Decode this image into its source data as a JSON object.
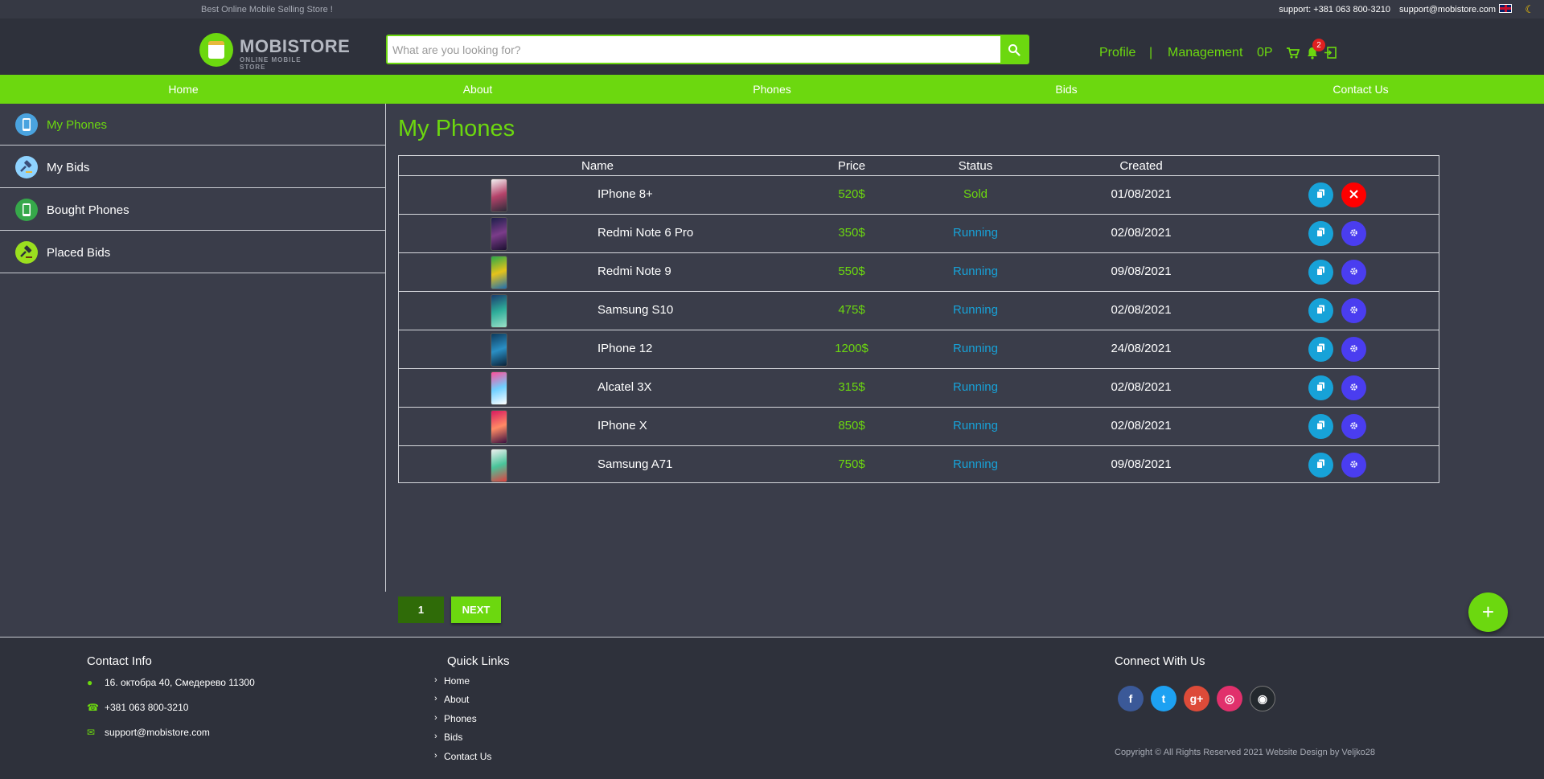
{
  "topbar": {
    "tagline": "Best Online Mobile Selling Store !",
    "phone": "support: +381 063 800-3210",
    "email": "support@mobistore.com"
  },
  "header": {
    "logo_title": "MOBISTORE",
    "logo_subtitle": "ONLINE MOBILE STORE",
    "search_placeholder": "What are you looking for?",
    "profile": "Profile",
    "separator": "|",
    "management": "Management",
    "points": "0P",
    "notification_count": "2"
  },
  "nav": [
    "Home",
    "About",
    "Phones",
    "Bids",
    "Contact Us"
  ],
  "sidebar": [
    {
      "label": "My Phones",
      "icon": "phone-icon",
      "active": true
    },
    {
      "label": "My Bids",
      "icon": "gavel-icon",
      "active": false
    },
    {
      "label": "Bought Phones",
      "icon": "phone-icon",
      "active": false
    },
    {
      "label": "Placed Bids",
      "icon": "gavel-icon",
      "active": false
    }
  ],
  "main": {
    "title": "My Phones",
    "columns": [
      "Name",
      "Price",
      "Status",
      "Created"
    ],
    "rows": [
      {
        "name": "IPhone 8+",
        "price": "520$",
        "status": "Sold",
        "created": "01/08/2021",
        "thumb": [
          "#f2f2f2",
          "#b5436a",
          "#2c2c3a"
        ]
      },
      {
        "name": "Redmi Note 6 Pro",
        "price": "350$",
        "status": "Running",
        "created": "02/08/2021",
        "thumb": [
          "#1d1f4a",
          "#7b3c8a",
          "#1b1030"
        ]
      },
      {
        "name": "Redmi Note 9",
        "price": "550$",
        "status": "Running",
        "created": "09/08/2021",
        "thumb": [
          "#2aa84a",
          "#e6c21a",
          "#1e6fb0"
        ]
      },
      {
        "name": "Samsung S10",
        "price": "475$",
        "status": "Running",
        "created": "02/08/2021",
        "thumb": [
          "#1a3b6e",
          "#2fae9a",
          "#9be0c8"
        ]
      },
      {
        "name": "IPhone 12",
        "price": "1200$",
        "status": "Running",
        "created": "24/08/2021",
        "thumb": [
          "#0d3a5c",
          "#2a8fc4",
          "#0b2238"
        ]
      },
      {
        "name": "Alcatel 3X",
        "price": "315$",
        "status": "Running",
        "created": "02/08/2021",
        "thumb": [
          "#ff4f9a",
          "#6fd0ff",
          "#ffffff"
        ]
      },
      {
        "name": "IPhone X",
        "price": "850$",
        "status": "Running",
        "created": "02/08/2021",
        "thumb": [
          "#d81b60",
          "#ff8a65",
          "#3a1040"
        ]
      },
      {
        "name": "Samsung A71",
        "price": "750$",
        "status": "Running",
        "created": "09/08/2021",
        "thumb": [
          "#f0f0f0",
          "#49c49a",
          "#e04040"
        ]
      }
    ]
  },
  "pagination": {
    "current": "1",
    "next": "NEXT"
  },
  "fab": "+",
  "footer": {
    "contact_title": "Contact Info",
    "address": "16. октобра 40, Смедерево 11300",
    "phone": "+381 063 800-3210",
    "email": "support@mobistore.com",
    "links_title": "Quick Links",
    "links": [
      "Home",
      "About",
      "Phones",
      "Bids",
      "Contact Us"
    ],
    "connect_title": "Connect With Us",
    "social": [
      {
        "name": "facebook-icon",
        "glyph": "f",
        "color": "#3b5998"
      },
      {
        "name": "twitter-icon",
        "glyph": "t",
        "color": "#1da1f2"
      },
      {
        "name": "google-plus-icon",
        "glyph": "g+",
        "color": "#dd4b39"
      },
      {
        "name": "instagram-icon",
        "glyph": "◎",
        "color": "#e1306c"
      },
      {
        "name": "github-icon",
        "glyph": "◉",
        "color": "#24292e"
      }
    ],
    "copyright": "Copyright © All Rights Reserved 2021 Website Design by Veljko28"
  },
  "colors": {
    "accent": "#6cd80f",
    "running": "#17a2d8",
    "sold": "#6cd80f",
    "danger": "#ff0000",
    "settings": "#4a3df0"
  }
}
